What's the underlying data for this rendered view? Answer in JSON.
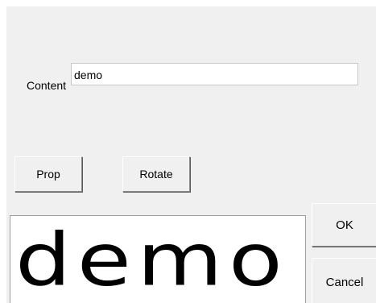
{
  "dialog": {
    "content_label": "Content",
    "content_value": "demo",
    "buttons": {
      "prop": "Prop",
      "rotate": "Rotate",
      "ok": "OK",
      "cancel": "Cancel"
    },
    "preview_text": "demo"
  }
}
